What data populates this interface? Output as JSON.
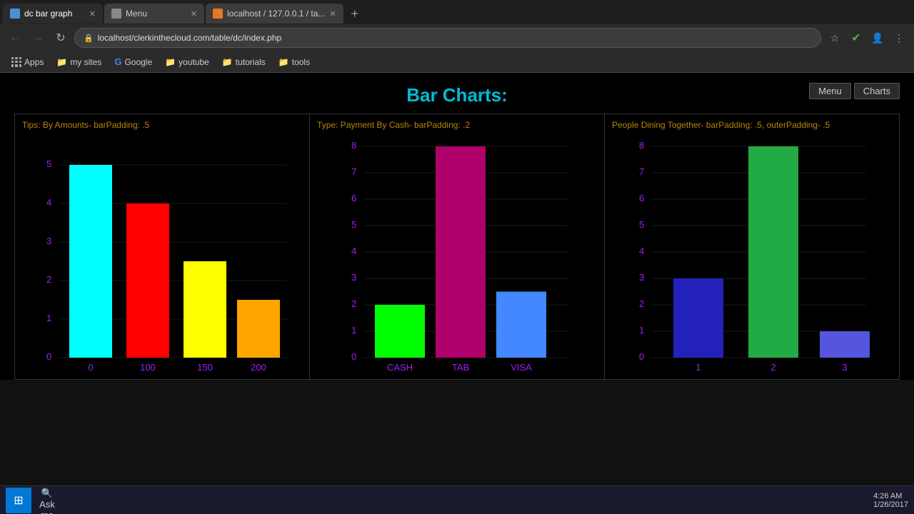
{
  "browser": {
    "tabs": [
      {
        "label": "dc bar graph",
        "active": true,
        "favicon_color": "#4a90d9"
      },
      {
        "label": "Menu",
        "active": false,
        "favicon_color": "#999"
      },
      {
        "label": "localhost / 127.0.0.1 / ta...",
        "active": false,
        "favicon_color": "#e87722"
      }
    ],
    "address": "localhost/clerkinthecloud.com/table/dc/index.php",
    "bookmarks": [
      "Apps",
      "my sites",
      "Google",
      "youtube",
      "tutorials",
      "tools"
    ]
  },
  "page": {
    "title": "Bar Charts:",
    "menu_btn": "Menu",
    "charts_btn": "Charts"
  },
  "charts": [
    {
      "title": "Tips: By Amounts- barPadding: .5",
      "y_labels": [
        "0",
        "1",
        "2",
        "3",
        "4",
        "5"
      ],
      "bars": [
        {
          "label": "0",
          "value": 5,
          "max": 5,
          "color": "cyan"
        },
        {
          "label": "100",
          "value": 4,
          "max": 5,
          "color": "red"
        },
        {
          "label": "150",
          "value": 2.5,
          "max": 5,
          "color": "yellow"
        },
        {
          "label": "200",
          "value": 1.5,
          "max": 5,
          "color": "orange"
        }
      ]
    },
    {
      "title": "Type: Payment By Cash- barPadding: .2",
      "y_labels": [
        "0",
        "1",
        "2",
        "3",
        "4",
        "5",
        "6",
        "7",
        "8"
      ],
      "bars": [
        {
          "label": "CASH",
          "value": 2,
          "max": 8,
          "color": "lime"
        },
        {
          "label": "TAB",
          "value": 8,
          "max": 8,
          "color": "#b0006b"
        },
        {
          "label": "VISA",
          "value": 2.5,
          "max": 8,
          "color": "#4488ff"
        }
      ]
    },
    {
      "title": "People Dining Together- barPadding: .5, outerPadding- .5",
      "y_labels": [
        "0",
        "1",
        "2",
        "3",
        "4",
        "5",
        "6",
        "7",
        "8"
      ],
      "bars": [
        {
          "label": "1",
          "value": 3,
          "max": 8,
          "color": "#2020cc"
        },
        {
          "label": "2",
          "value": 8,
          "max": 8,
          "color": "#22aa44"
        },
        {
          "label": "3",
          "value": 1,
          "max": 8,
          "color": "#5555dd"
        }
      ]
    }
  ],
  "taskbar": {
    "time": "4:26 AM",
    "date": "1/26/2017"
  }
}
